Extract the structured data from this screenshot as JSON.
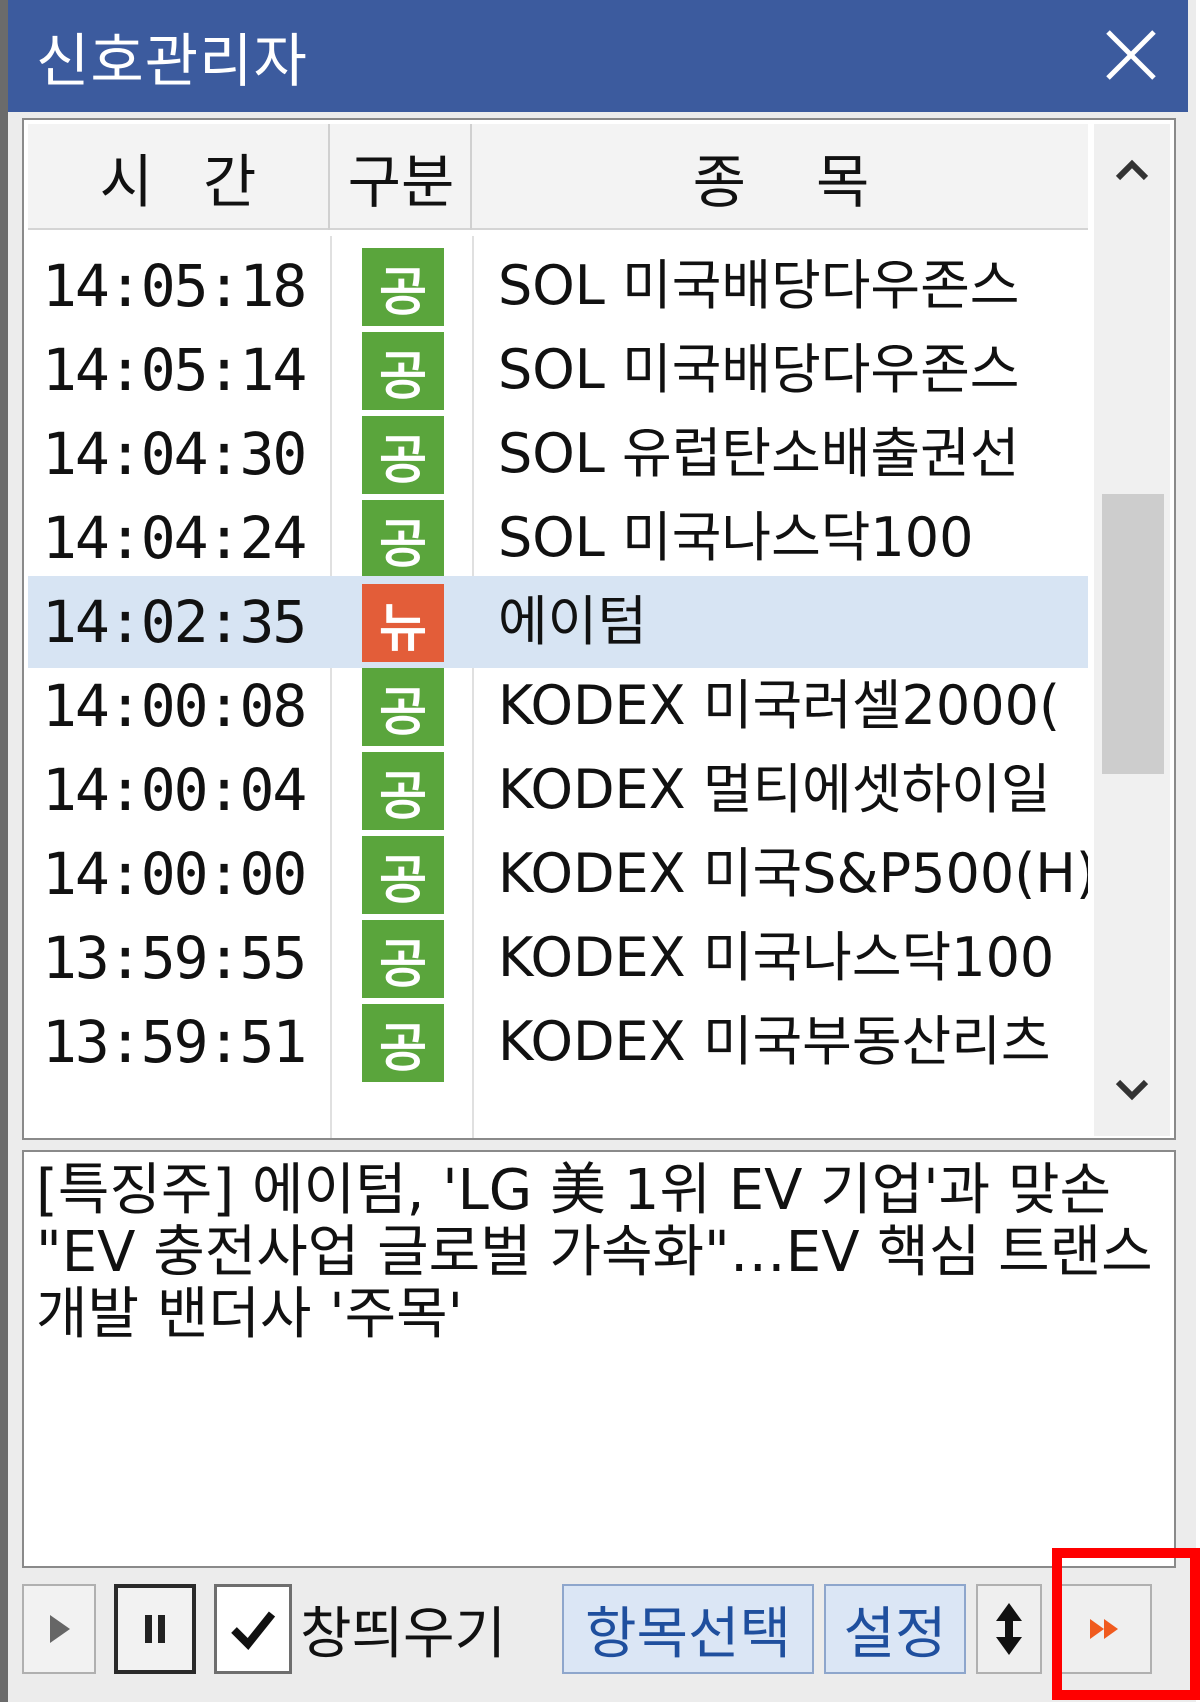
{
  "window": {
    "title": "신호관리자"
  },
  "colors": {
    "titlebar": "#3c5b9e",
    "badge_green": "#5aa53c",
    "badge_red": "#e35d39",
    "selected_row": "#d7e4f3",
    "button_blue_text": "#1f4f9e"
  },
  "table": {
    "columns": [
      "시간",
      "구분",
      "종목"
    ],
    "rows": [
      {
        "time": "14:05:18",
        "kind": "공",
        "kind_color": "#5aa53c",
        "name": "SOL 미국배당다우존스",
        "selected": false
      },
      {
        "time": "14:05:14",
        "kind": "공",
        "kind_color": "#5aa53c",
        "name": "SOL 미국배당다우존스",
        "selected": false
      },
      {
        "time": "14:04:30",
        "kind": "공",
        "kind_color": "#5aa53c",
        "name": "SOL 유럽탄소배출권선",
        "selected": false
      },
      {
        "time": "14:04:24",
        "kind": "공",
        "kind_color": "#5aa53c",
        "name": "SOL 미국나스닥100",
        "selected": false
      },
      {
        "time": "14:02:35",
        "kind": "뉴",
        "kind_color": "#e35d39",
        "name": "에이텀",
        "selected": true
      },
      {
        "time": "14:00:08",
        "kind": "공",
        "kind_color": "#5aa53c",
        "name": "KODEX 미국러셀2000(",
        "selected": false
      },
      {
        "time": "14:00:04",
        "kind": "공",
        "kind_color": "#5aa53c",
        "name": "KODEX 멀티에셋하이일",
        "selected": false
      },
      {
        "time": "14:00:00",
        "kind": "공",
        "kind_color": "#5aa53c",
        "name": "KODEX 미국S&P500(H)",
        "selected": false
      },
      {
        "time": "13:59:55",
        "kind": "공",
        "kind_color": "#5aa53c",
        "name": "KODEX 미국나스닥100",
        "selected": false
      },
      {
        "time": "13:59:51",
        "kind": "공",
        "kind_color": "#5aa53c",
        "name": "KODEX 미국부동산리츠",
        "selected": false
      }
    ]
  },
  "detail": {
    "text": "[특징주] 에이텀, 'LG 美 1위 EV 기업'과 맞손 \"EV 충전사업 글로벌 가속화\"…EV 핵심 트랜스 개발 밴더사 '주목'"
  },
  "toolbar": {
    "checkbox_label": "창띄우기",
    "checkbox_checked": true,
    "item_select_label": "항목선택",
    "settings_label": "설정"
  },
  "icons": {
    "close": "close-icon",
    "scroll_up": "chevron-up-icon",
    "scroll_down": "chevron-down-icon",
    "play": "play-icon",
    "pause": "pause-icon",
    "check": "check-icon",
    "updown": "up-down-arrow-icon",
    "fast_forward": "fast-forward-icon"
  }
}
